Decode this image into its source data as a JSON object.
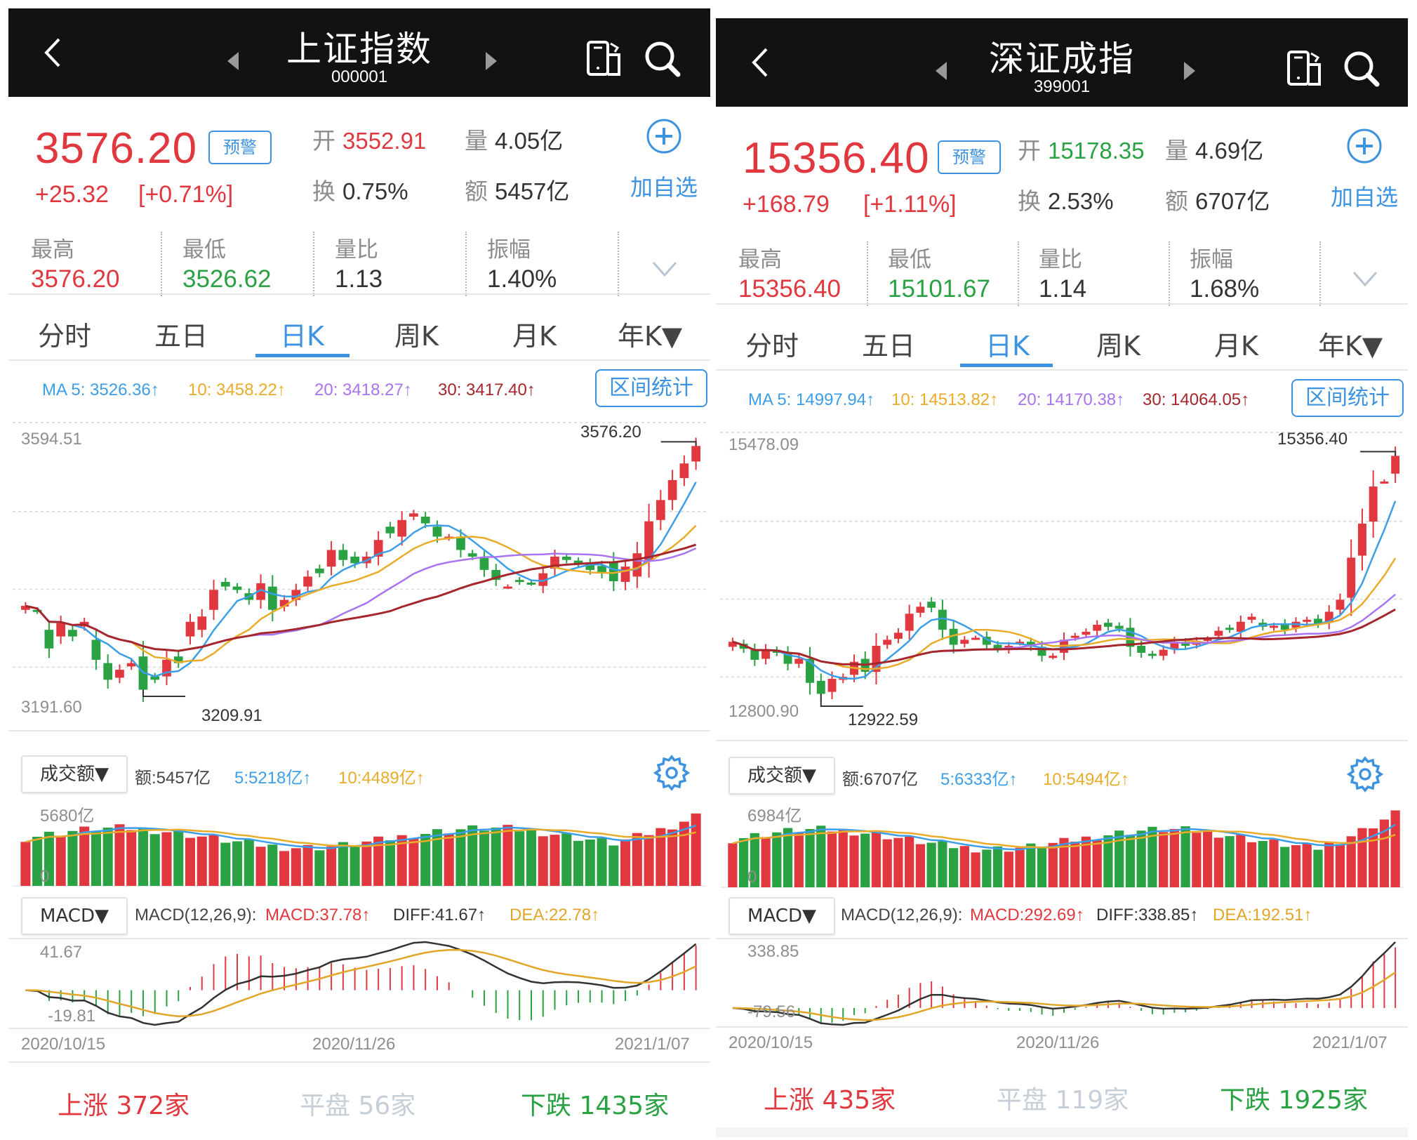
{
  "colors": {
    "up": "#e0383e",
    "down": "#2aa243",
    "accent": "#3d93df",
    "ma5": "#3d9ee8",
    "ma10": "#e9ac2a",
    "ma20": "#a874f0",
    "ma30": "#a5262c",
    "diff": "#333333",
    "dea": "#e1a629"
  },
  "panels": [
    {
      "header": {
        "title": "上证指数",
        "code": "000001",
        "back_icon": "chevron-left-icon",
        "prev_icon": "triangle-left-icon",
        "next_icon": "triangle-right-icon",
        "rotate_icon": "rotate-screen-icon",
        "search_icon": "search-icon"
      },
      "quote": {
        "price": "3576.20",
        "alert_label": "预警",
        "change": "+25.32",
        "change_pct": "[+0.71%]",
        "open_label": "开",
        "open": "3552.91",
        "open_color": "red",
        "volume_label": "量",
        "volume": "4.05亿",
        "turnover_label": "换",
        "turnover": "0.75%",
        "amount_label": "额",
        "amount": "5457亿",
        "add_label": "加自选",
        "stats": [
          {
            "label": "最高",
            "value": "3576.20",
            "color": "red"
          },
          {
            "label": "最低",
            "value": "3526.62",
            "color": "green"
          },
          {
            "label": "量比",
            "value": "1.13",
            "color": "plain"
          },
          {
            "label": "振幅",
            "value": "1.40%",
            "color": "plain"
          }
        ]
      },
      "tabs": [
        {
          "label": "分时"
        },
        {
          "label": "五日"
        },
        {
          "label": "日K",
          "active": true
        },
        {
          "label": "周K"
        },
        {
          "label": "月K"
        },
        {
          "label": "年K▼"
        }
      ],
      "ma": {
        "ma5": "MA 5: 3526.36↑",
        "ma10": "10: 3458.22↑",
        "ma20": "20: 3418.27↑",
        "ma30": "30: 3417.40↑",
        "range_label": "区间统计"
      },
      "kline": {
        "axis_high": "3594.51",
        "axis_low": "3191.60",
        "max_mark": "3576.20",
        "min_mark": "3209.91"
      },
      "volume": {
        "dropdown": "成交额▼",
        "amount": "额:5457亿",
        "ma5": "5:5218亿↑",
        "ma10": "10:4489亿↑",
        "axis_max": "5680亿",
        "axis_zero": "0",
        "settings_icon": "gear-icon"
      },
      "macd": {
        "dropdown": "MACD▼",
        "params": "MACD(12,26,9):",
        "macd": "MACD:37.78↑",
        "diff": "DIFF:41.67↑",
        "dea": "DEA:22.78↑",
        "axis_high": "41.67",
        "axis_low": "-19.81"
      },
      "dates": [
        "2020/10/15",
        "2020/11/26",
        "2021/1/07"
      ],
      "breadth": {
        "up_label": "上涨",
        "up": "372家",
        "flat_label": "平盘",
        "flat": "56家",
        "down_label": "下跌",
        "down": "1435家"
      }
    },
    {
      "header": {
        "title": "深证成指",
        "code": "399001",
        "back_icon": "chevron-left-icon",
        "prev_icon": "triangle-left-icon",
        "next_icon": "triangle-right-icon",
        "rotate_icon": "rotate-screen-icon",
        "search_icon": "search-icon"
      },
      "quote": {
        "price": "15356.40",
        "alert_label": "预警",
        "change": "+168.79",
        "change_pct": "[+1.11%]",
        "open_label": "开",
        "open": "15178.35",
        "open_color": "green",
        "volume_label": "量",
        "volume": "4.69亿",
        "turnover_label": "换",
        "turnover": "2.53%",
        "amount_label": "额",
        "amount": "6707亿",
        "add_label": "加自选",
        "stats": [
          {
            "label": "最高",
            "value": "15356.40",
            "color": "red"
          },
          {
            "label": "最低",
            "value": "15101.67",
            "color": "green"
          },
          {
            "label": "量比",
            "value": "1.14",
            "color": "plain"
          },
          {
            "label": "振幅",
            "value": "1.68%",
            "color": "plain"
          }
        ]
      },
      "tabs": [
        {
          "label": "分时"
        },
        {
          "label": "五日"
        },
        {
          "label": "日K",
          "active": true
        },
        {
          "label": "周K"
        },
        {
          "label": "月K"
        },
        {
          "label": "年K▼"
        }
      ],
      "ma": {
        "ma5": "MA 5: 14997.94↑",
        "ma10": "10: 14513.82↑",
        "ma20": "20: 14170.38↑",
        "ma30": "30: 14064.05↑",
        "range_label": "区间统计"
      },
      "kline": {
        "axis_high": "15478.09",
        "axis_low": "12800.90",
        "max_mark": "15356.40",
        "min_mark": "12922.59"
      },
      "volume": {
        "dropdown": "成交额▼",
        "amount": "额:6707亿",
        "ma5": "5:6333亿↑",
        "ma10": "10:5494亿↑",
        "axis_max": "6984亿",
        "axis_zero": "0",
        "settings_icon": "gear-icon"
      },
      "macd": {
        "dropdown": "MACD▼",
        "params": "MACD(12,26,9):",
        "macd": "MACD:292.69↑",
        "diff": "DIFF:338.85↑",
        "dea": "DEA:192.51↑",
        "axis_high": "338.85",
        "axis_low": "-79.56"
      },
      "dates": [
        "2020/10/15",
        "2020/11/26",
        "2021/1/07"
      ],
      "breadth": {
        "up_label": "上涨",
        "up": "435家",
        "flat_label": "平盘",
        "flat": "119家",
        "down_label": "下跌",
        "down": "1925家"
      }
    }
  ],
  "chart_data": [
    {
      "type": "candlestick",
      "title": "上证指数 日K",
      "ylim": [
        3191.6,
        3594.51
      ],
      "x_ticks": [
        "2020/10/15",
        "2020/11/26",
        "2021/1/07"
      ],
      "ohlc_close": [
        3336,
        3328,
        3272,
        3310,
        3290,
        3312,
        3255,
        3225,
        3240,
        3250,
        3210,
        3225,
        3255,
        3250,
        3312,
        3320,
        3360,
        3365,
        3360,
        3345,
        3370,
        3330,
        3345,
        3360,
        3380,
        3385,
        3420,
        3405,
        3400,
        3410,
        3435,
        3445,
        3465,
        3475,
        3460,
        3440,
        3440,
        3420,
        3410,
        3390,
        3375,
        3365,
        3372,
        3370,
        3385,
        3410,
        3405,
        3400,
        3390,
        3385,
        3373,
        3395,
        3415,
        3463,
        3495,
        3525,
        3550,
        3576.2
      ],
      "ohlc_open": [
        3330,
        3330,
        3300,
        3290,
        3300,
        3305,
        3285,
        3250,
        3228,
        3245,
        3260,
        3230,
        3230,
        3260,
        3290,
        3300,
        3330,
        3372,
        3365,
        3355,
        3345,
        3365,
        3335,
        3345,
        3365,
        3392,
        3395,
        3420,
        3410,
        3400,
        3410,
        3455,
        3440,
        3470,
        3470,
        3455,
        3438,
        3440,
        3415,
        3408,
        3390,
        3365,
        3375,
        3371,
        3366,
        3392,
        3410,
        3404,
        3400,
        3396,
        3402,
        3372,
        3380,
        3405,
        3465,
        3495,
        3528,
        3552.91
      ],
      "ma_series_note": "MA5/10/20/30 overlay lines",
      "series_last": {
        "MA5": 3526.36,
        "MA10": 3458.22,
        "MA20": 3418.27,
        "MA30": 3417.4
      }
    },
    {
      "type": "candlestick",
      "title": "深证成指 日K",
      "ylim": [
        12800.9,
        15478.09
      ],
      "x_ticks": [
        "2020/10/15",
        "2020/11/26",
        "2021/1/07"
      ],
      "ohlc_close": [
        13500,
        13430,
        13320,
        13420,
        13390,
        13280,
        13330,
        13090,
        12980,
        13130,
        13150,
        13300,
        13200,
        13460,
        13520,
        13590,
        13780,
        13850,
        13840,
        13620,
        13470,
        13520,
        13540,
        13470,
        13430,
        13460,
        13500,
        13450,
        13360,
        13360,
        13520,
        13560,
        13600,
        13670,
        13650,
        13630,
        13450,
        13390,
        13360,
        13420,
        13500,
        13460,
        13510,
        13530,
        13610,
        13620,
        13700,
        13750,
        13650,
        13660,
        13620,
        13700,
        13720,
        13680,
        13800,
        13920,
        14340,
        14680,
        15050,
        15100,
        15356.4
      ],
      "ohlc_open": [
        13450,
        13480,
        13420,
        13330,
        13420,
        13390,
        13280,
        13330,
        13110,
        13000,
        13120,
        13170,
        13330,
        13200,
        13470,
        13530,
        13610,
        13790,
        13900,
        13820,
        13630,
        13480,
        13540,
        13550,
        13470,
        13420,
        13490,
        13500,
        13450,
        13350,
        13390,
        13540,
        13570,
        13610,
        13690,
        13660,
        13640,
        13460,
        13380,
        13360,
        13430,
        13500,
        13470,
        13520,
        13560,
        13640,
        13600,
        13720,
        13690,
        13640,
        13680,
        13640,
        13700,
        13730,
        13690,
        13820,
        13940,
        14360,
        14700,
        15100,
        15178.35
      ],
      "series_last": {
        "MA5": 14997.94,
        "MA10": 14513.82,
        "MA20": 14170.38,
        "MA30": 14064.05
      }
    },
    {
      "type": "bar",
      "title": "成交额 (上证)",
      "ylim": [
        0,
        5680
      ],
      "unit": "亿",
      "last": 5457,
      "series_last": {
        "MA5": 5218,
        "MA10": 4489
      }
    },
    {
      "type": "bar",
      "title": "成交额 (深证)",
      "ylim": [
        0,
        6984
      ],
      "unit": "亿",
      "last": 6707,
      "series_last": {
        "MA5": 6333,
        "MA10": 5494
      }
    },
    {
      "type": "line",
      "title": "MACD(12,26,9) 上证",
      "ylim": [
        -19.81,
        41.67
      ],
      "last": {
        "MACD": 37.78,
        "DIFF": 41.67,
        "DEA": 22.78
      }
    },
    {
      "type": "line",
      "title": "MACD(12,26,9) 深证",
      "ylim": [
        -79.56,
        338.85
      ],
      "last": {
        "MACD": 292.69,
        "DIFF": 338.85,
        "DEA": 192.51
      }
    }
  ]
}
